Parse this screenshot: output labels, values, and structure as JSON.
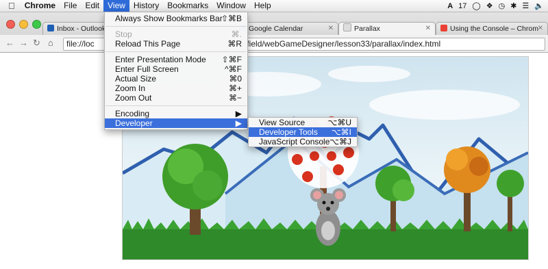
{
  "menubar": {
    "app_name": "Chrome",
    "items": [
      "File",
      "Edit",
      "View",
      "History",
      "Bookmarks",
      "Window",
      "Help"
    ],
    "status": {
      "adobe_count": "17"
    }
  },
  "tabs": [
    {
      "title": "Inbox - Outlook W",
      "icon_color": "#1e5fb4"
    },
    {
      "title": "",
      "icon_color": "#bbbbbb"
    },
    {
      "title": "Google Calendar",
      "icon_color": "#3b78e7"
    },
    {
      "title": "Parallax",
      "icon_color": "#dddddd"
    },
    {
      "title": "Using the Console – Chrom",
      "icon_color": "#e94235"
    }
  ],
  "address_bar": {
    "visible_start": "file://loc",
    "visible_end": "enfield/webGameDesigner/lesson33/parallax/index.html"
  },
  "view_menu": {
    "items": [
      {
        "label": "Always Show Bookmarks Bar",
        "shortcut": "⇧⌘B"
      },
      {
        "label": "Stop",
        "shortcut": "⌘.",
        "disabled": true
      },
      {
        "label": "Reload This Page",
        "shortcut": "⌘R"
      },
      {
        "label": "Enter Presentation Mode",
        "shortcut": "⇧⌘F"
      },
      {
        "label": "Enter Full Screen",
        "shortcut": "^⌘F"
      },
      {
        "label": "Actual Size",
        "shortcut": "⌘0"
      },
      {
        "label": "Zoom In",
        "shortcut": "⌘+"
      },
      {
        "label": "Zoom Out",
        "shortcut": "⌘−"
      },
      {
        "label": "Encoding",
        "shortcut": "▶"
      },
      {
        "label": "Developer",
        "shortcut": "▶"
      }
    ]
  },
  "developer_menu": {
    "items": [
      {
        "label": "View Source",
        "shortcut": "⌥⌘U"
      },
      {
        "label": "Developer Tools",
        "shortcut": "⌥⌘I"
      },
      {
        "label": "JavaScript Console",
        "shortcut": "⌥⌘J"
      }
    ]
  },
  "colors": {
    "menu_highlight": "#3b6fdc",
    "grass": "#2f8a2a",
    "mountain": "#2f5fae"
  }
}
